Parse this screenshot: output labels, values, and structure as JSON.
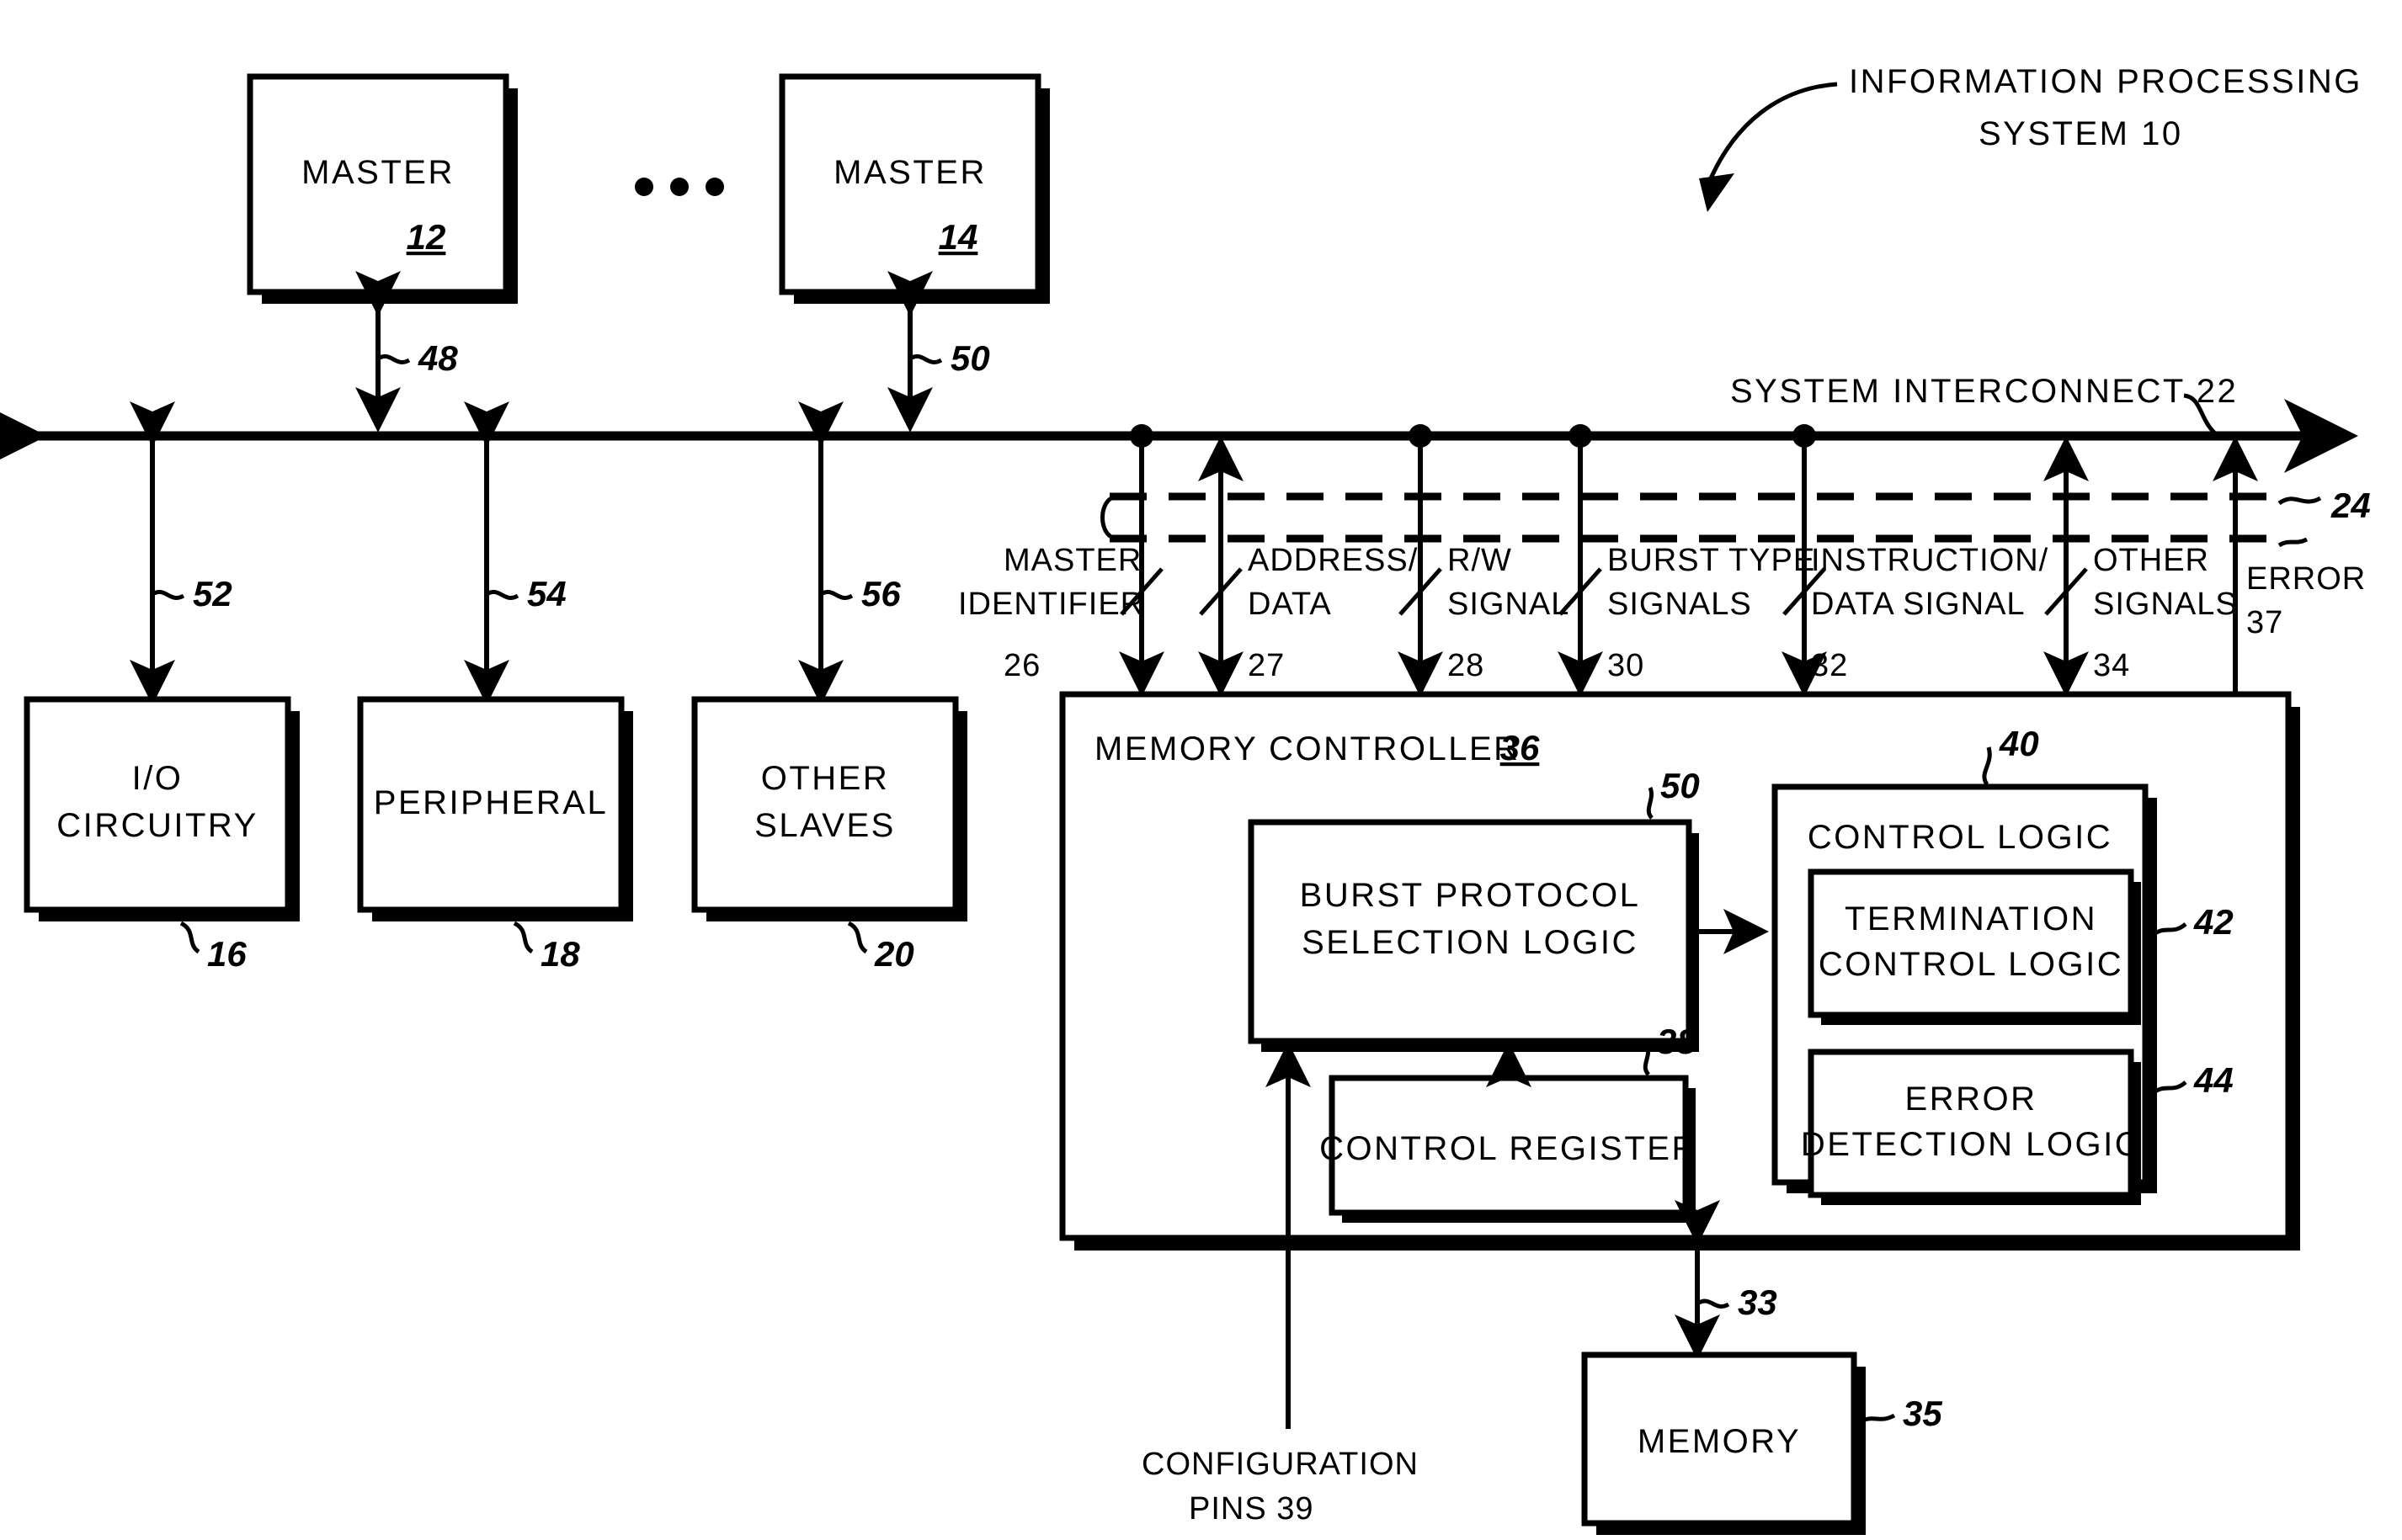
{
  "figure": {
    "title_label": "INFORMATION PROCESSING",
    "title_label_2": "SYSTEM 10",
    "ellipsis": "• • •"
  },
  "masters": [
    {
      "name": "master-12",
      "label": "MASTER",
      "ref": "12",
      "bus_ref": "48"
    },
    {
      "name": "master-14",
      "label": "MASTER",
      "ref": "14",
      "bus_ref": "50"
    }
  ],
  "interconnect": {
    "label": "SYSTEM INTERCONNECT 22",
    "bundle_ref": "24"
  },
  "slaves": [
    {
      "label_line1": "I/O",
      "label_line2": "CIRCUITRY",
      "ref": "16",
      "bus_ref": "52"
    },
    {
      "label_line1": "PERIPHERAL",
      "label_line2": "",
      "ref": "18",
      "bus_ref": "54"
    },
    {
      "label_line1": "OTHER",
      "label_line2": "SLAVES",
      "ref": "20",
      "bus_ref": "56"
    }
  ],
  "signals": [
    {
      "line1": "MASTER",
      "line2": "IDENTIFIER",
      "ref": "26"
    },
    {
      "line1": "ADDRESS/",
      "line2": "DATA",
      "ref": "27"
    },
    {
      "line1": "R/W",
      "line2": "SIGNAL",
      "ref": "28"
    },
    {
      "line1": "BURST TYPE",
      "line2": "SIGNALS",
      "ref": "30"
    },
    {
      "line1": "INSTRUCTION/",
      "line2": "DATA SIGNAL",
      "ref": "32"
    },
    {
      "line1": "OTHER",
      "line2": "SIGNALS",
      "ref": "34"
    },
    {
      "line1": "ERROR",
      "line2": "",
      "ref": "37"
    }
  ],
  "memory_controller": {
    "label": "MEMORY CONTROLLER",
    "ref": "36",
    "burst_logic": {
      "line1": "BURST PROTOCOL",
      "line2": "SELECTION LOGIC",
      "ref": "50"
    },
    "control_register": {
      "label": "CONTROL REGISTER",
      "ref": "38"
    },
    "control_logic": {
      "label": "CONTROL LOGIC",
      "ref": "40",
      "children": [
        {
          "line1": "TERMINATION",
          "line2": "CONTROL LOGIC",
          "ref": "42"
        },
        {
          "line1": "ERROR",
          "line2": "DETECTION LOGIC",
          "ref": "44"
        }
      ]
    },
    "config_pins": {
      "line1": "CONFIGURATION",
      "line2": "PINS 39"
    },
    "memory_link_ref": "33"
  },
  "memory": {
    "label": "MEMORY",
    "ref": "35"
  }
}
